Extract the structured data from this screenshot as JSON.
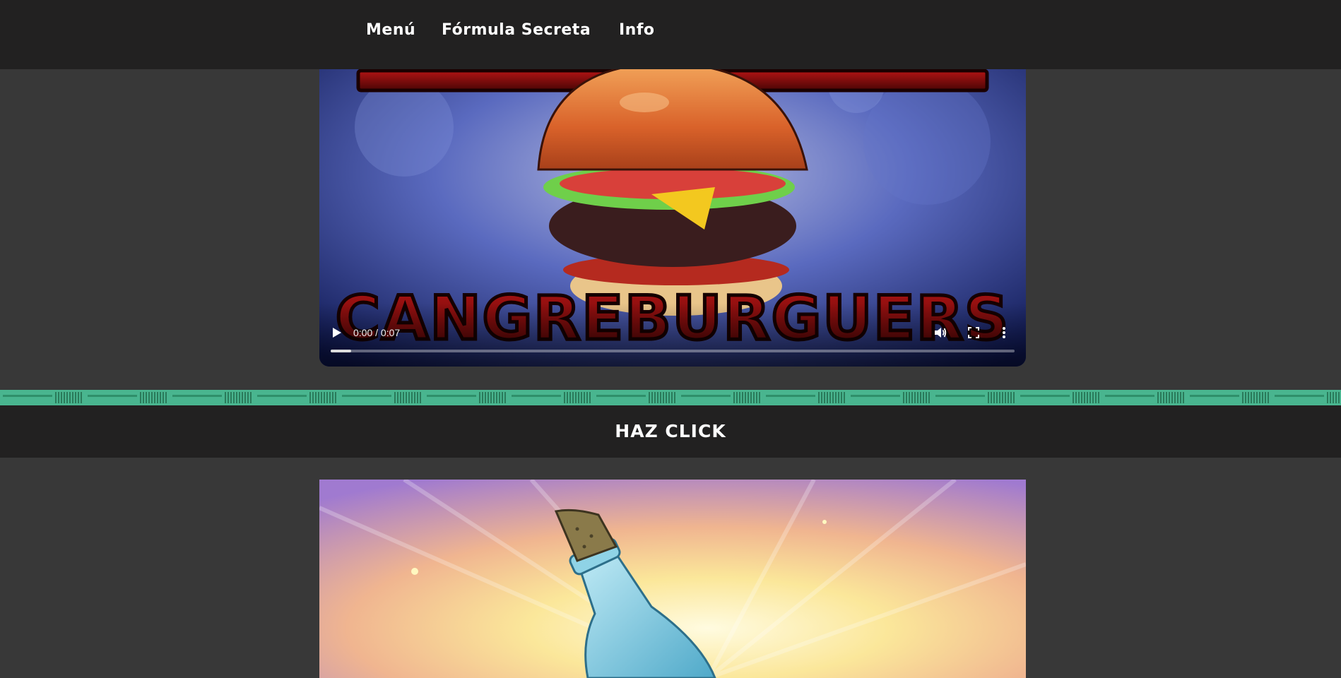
{
  "nav": {
    "items": [
      {
        "label": "Menú"
      },
      {
        "label": "Fórmula Secreta"
      },
      {
        "label": "Info"
      }
    ]
  },
  "video": {
    "title_text": "CANGREBURGUERS",
    "current_time": "0:00",
    "duration": "0:07",
    "time_display": "0:00 / 0:07",
    "progress_fraction": 0.03,
    "icons": [
      "play-icon",
      "volume-icon",
      "fullscreen-icon",
      "more-options-icon"
    ]
  },
  "section": {
    "heading": "HAZ CLICK"
  },
  "colors": {
    "background": "#383838",
    "nav_bar": "#222121",
    "strip": "#49b58f",
    "title_red": "#8a0f0f"
  }
}
